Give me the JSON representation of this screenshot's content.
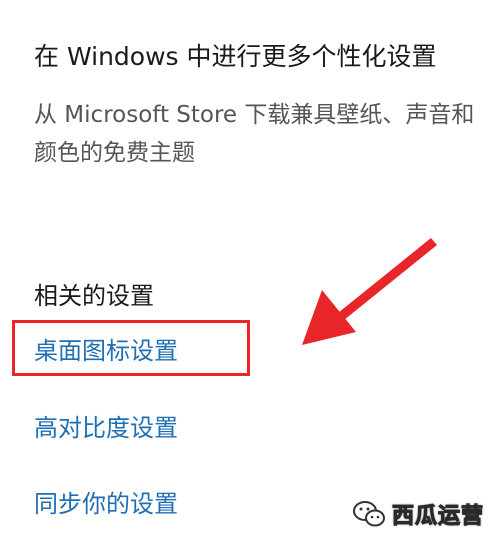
{
  "heading": "在 Windows 中进行更多个性化设置",
  "description": "从 Microsoft Store 下载兼具壁纸、声音和颜色的免费主题",
  "related": {
    "title": "相关的设置",
    "links": [
      "桌面图标设置",
      "高对比度设置",
      "同步你的设置"
    ]
  },
  "watermark": {
    "text": "西瓜运营",
    "icon": "wechat-icon"
  },
  "colors": {
    "link": "#1f6fb5",
    "highlight": "#e8262a"
  }
}
